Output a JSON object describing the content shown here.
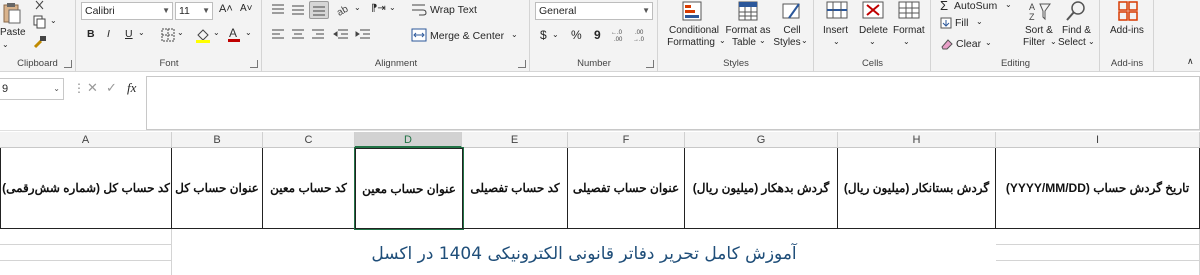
{
  "ribbon": {
    "clipboard": {
      "label": "Clipboard",
      "paste": "Paste"
    },
    "font": {
      "label": "Font",
      "name": "Calibri",
      "size": "11",
      "bold": "B",
      "italic": "I",
      "underline": "U",
      "grow": "A˄",
      "shrink": "A˅"
    },
    "alignment": {
      "label": "Alignment",
      "wrap_text": "Wrap Text",
      "merge_center": "Merge & Center"
    },
    "number": {
      "label": "Number",
      "format": "General",
      "currency": "$",
      "percent": "%",
      "comma": "9"
    },
    "styles": {
      "label": "Styles",
      "conditional": "Conditional",
      "formatting": "Formatting",
      "format_as": "Format as",
      "table": "Table",
      "cell": "Cell",
      "cell_styles": "Styles"
    },
    "cells": {
      "label": "Cells",
      "insert": "Insert",
      "delete": "Delete",
      "format": "Format"
    },
    "editing": {
      "label": "Editing",
      "autosum": "AutoSum",
      "fill": "Fill",
      "clear": "Clear",
      "sort": "Sort &",
      "filter": "Filter",
      "find": "Find &",
      "select": "Select"
    },
    "addins": {
      "label": "Add-ins",
      "addins_btn": "Add-ins"
    }
  },
  "formula_bar": {
    "name_box": "9",
    "fx": "fx",
    "cancel": "✕",
    "enter": "✓",
    "value": ""
  },
  "columns": [
    "A",
    "B",
    "C",
    "D",
    "E",
    "F",
    "G",
    "H",
    "I"
  ],
  "selected_column": "D",
  "headers": [
    "کد حساب کل (شماره شش‌رقمی)",
    "عنوان حساب کل",
    "کد حساب معین",
    "عنوان حساب معین",
    "کد حساب تفصیلی",
    "عنوان حساب تفصیلی",
    "گردش بدهکار (میلیون ریال)",
    "گردش بستانکار (میلیون ریال)",
    "تاریخ گردش حساب (YYYY/MM/DD)"
  ],
  "banner": "آموزش کامل تحریر دفاتر قانونی الکترونیکی 1404 در اکسل",
  "colors": {
    "accent": "#217346",
    "banner_text": "#1f4e79",
    "ribbon_bg": "#f3f3f3"
  }
}
